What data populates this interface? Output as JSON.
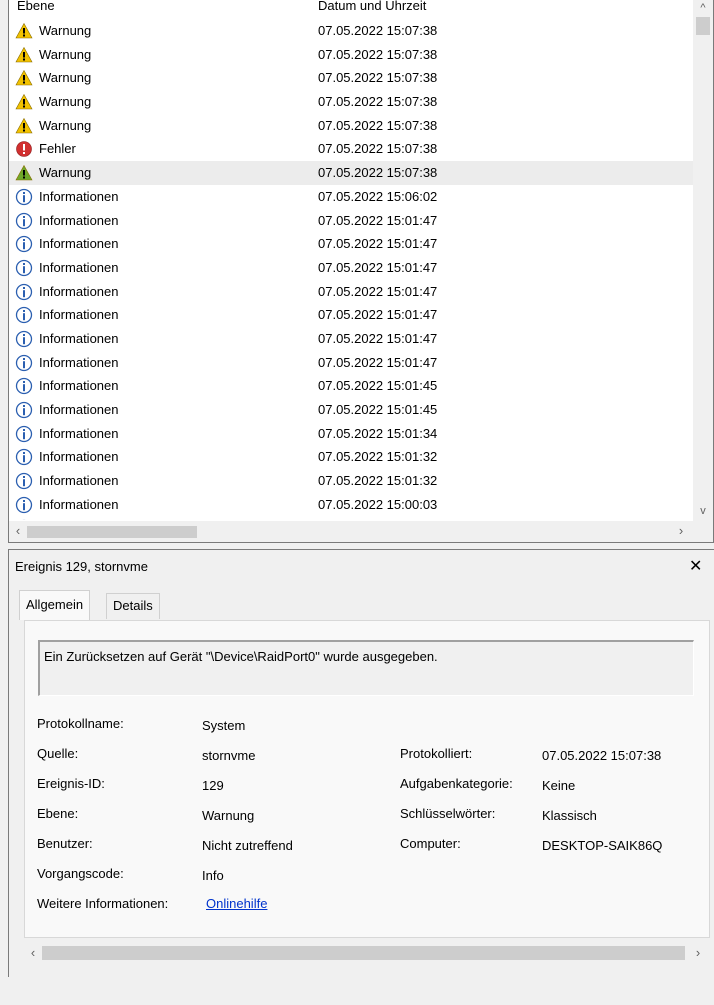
{
  "list": {
    "columns": {
      "level": "Ebene",
      "date": "Datum und Uhrzeit"
    },
    "rows": [
      {
        "icon": "warning-icon",
        "level": "Warnung",
        "date": "07.05.2022 15:07:38"
      },
      {
        "icon": "warning-icon",
        "level": "Warnung",
        "date": "07.05.2022 15:07:38"
      },
      {
        "icon": "warning-icon",
        "level": "Warnung",
        "date": "07.05.2022 15:07:38"
      },
      {
        "icon": "warning-icon",
        "level": "Warnung",
        "date": "07.05.2022 15:07:38"
      },
      {
        "icon": "warning-icon",
        "level": "Warnung",
        "date": "07.05.2022 15:07:38"
      },
      {
        "icon": "error-icon",
        "level": "Fehler",
        "date": "07.05.2022 15:07:38"
      },
      {
        "icon": "warning-icon",
        "level": "Warnung",
        "date": "07.05.2022 15:07:38",
        "selected": true
      },
      {
        "icon": "info-icon",
        "level": "Informationen",
        "date": "07.05.2022 15:06:02"
      },
      {
        "icon": "info-icon",
        "level": "Informationen",
        "date": "07.05.2022 15:01:47"
      },
      {
        "icon": "info-icon",
        "level": "Informationen",
        "date": "07.05.2022 15:01:47"
      },
      {
        "icon": "info-icon",
        "level": "Informationen",
        "date": "07.05.2022 15:01:47"
      },
      {
        "icon": "info-icon",
        "level": "Informationen",
        "date": "07.05.2022 15:01:47"
      },
      {
        "icon": "info-icon",
        "level": "Informationen",
        "date": "07.05.2022 15:01:47"
      },
      {
        "icon": "info-icon",
        "level": "Informationen",
        "date": "07.05.2022 15:01:47"
      },
      {
        "icon": "info-icon",
        "level": "Informationen",
        "date": "07.05.2022 15:01:47"
      },
      {
        "icon": "info-icon",
        "level": "Informationen",
        "date": "07.05.2022 15:01:45"
      },
      {
        "icon": "info-icon",
        "level": "Informationen",
        "date": "07.05.2022 15:01:45"
      },
      {
        "icon": "info-icon",
        "level": "Informationen",
        "date": "07.05.2022 15:01:34"
      },
      {
        "icon": "info-icon",
        "level": "Informationen",
        "date": "07.05.2022 15:01:32"
      },
      {
        "icon": "info-icon",
        "level": "Informationen",
        "date": "07.05.2022 15:01:32"
      },
      {
        "icon": "info-icon",
        "level": "Informationen",
        "date": "07.05.2022 15:00:03"
      },
      {
        "icon": "info-icon",
        "level": "",
        "date": ""
      }
    ],
    "scroll_left_glyph": "‹",
    "scroll_right_glyph": "›",
    "scroll_up_glyph": "^",
    "scroll_down_glyph": "v"
  },
  "detail": {
    "title": "Ereignis 129, stornvme",
    "close_glyph": "✕",
    "tabs": {
      "general": "Allgemein",
      "details": "Details"
    },
    "message": "Ein Zurücksetzen auf Gerät \"\\Device\\RaidPort0\" wurde ausgegeben.",
    "fields": {
      "log_name_label": "Protokollname:",
      "log_name_value": "System",
      "source_label": "Quelle:",
      "source_value": "stornvme",
      "logged_label": "Protokolliert:",
      "logged_value": "07.05.2022 15:07:38",
      "event_id_label": "Ereignis-ID:",
      "event_id_value": "129",
      "task_category_label": "Aufgabenkategorie:",
      "task_category_value": "Keine",
      "level_label": "Ebene:",
      "level_value": "Warnung",
      "keywords_label": "Schlüsselwörter:",
      "keywords_value": "Klassisch",
      "user_label": "Benutzer:",
      "user_value": "Nicht zutreffend",
      "computer_label": "Computer:",
      "computer_value": "DESKTOP-SAIK86Q",
      "opcode_label": "Vorgangscode:",
      "opcode_value": "Info",
      "more_info_label": "Weitere Informationen:",
      "more_info_link": "Onlinehilfe"
    },
    "scroll_left_glyph": "‹",
    "scroll_right_glyph": "›"
  },
  "colors": {
    "warning": "#f2c200",
    "warning_selected": "#6fa82a",
    "error": "#d12f2f",
    "info": "#2b5fb0",
    "link": "#0033cc"
  }
}
